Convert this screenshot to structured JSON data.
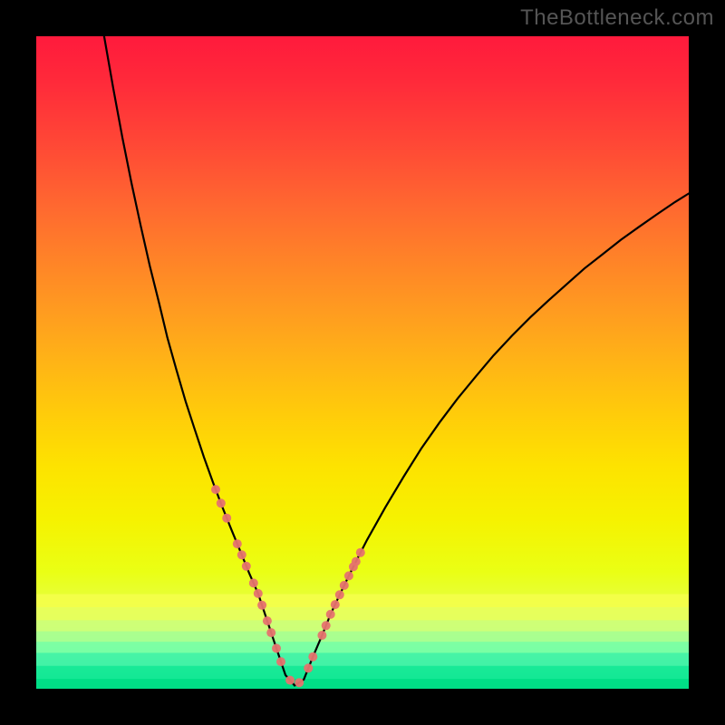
{
  "watermark": "TheBottleneck.com",
  "chart_data": {
    "type": "line",
    "title": "",
    "xlabel": "",
    "ylabel": "",
    "xlim": [
      0,
      100
    ],
    "ylim": [
      0,
      100
    ],
    "grid": false,
    "legend": null,
    "curve": {
      "description": "V-shaped bottleneck curve with minimum near x≈39",
      "min_x": 39,
      "points": [
        {
          "x": 10.4,
          "y": 100.0
        },
        {
          "x": 11.8,
          "y": 92.0
        },
        {
          "x": 13.2,
          "y": 84.5
        },
        {
          "x": 14.6,
          "y": 77.5
        },
        {
          "x": 16.0,
          "y": 71.0
        },
        {
          "x": 17.4,
          "y": 64.8
        },
        {
          "x": 18.8,
          "y": 59.2
        },
        {
          "x": 20.1,
          "y": 53.8
        },
        {
          "x": 21.5,
          "y": 48.8
        },
        {
          "x": 22.9,
          "y": 44.0
        },
        {
          "x": 24.3,
          "y": 39.7
        },
        {
          "x": 25.7,
          "y": 35.5
        },
        {
          "x": 27.1,
          "y": 31.6
        },
        {
          "x": 28.5,
          "y": 27.9
        },
        {
          "x": 29.9,
          "y": 24.4
        },
        {
          "x": 31.3,
          "y": 21.0
        },
        {
          "x": 32.6,
          "y": 17.8
        },
        {
          "x": 34.0,
          "y": 14.6
        },
        {
          "x": 35.4,
          "y": 10.4
        },
        {
          "x": 36.8,
          "y": 6.2
        },
        {
          "x": 38.2,
          "y": 2.1
        },
        {
          "x": 39.6,
          "y": 0.5
        },
        {
          "x": 41.0,
          "y": 1.4
        },
        {
          "x": 42.4,
          "y": 4.9
        },
        {
          "x": 43.8,
          "y": 8.2
        },
        {
          "x": 45.1,
          "y": 11.4
        },
        {
          "x": 46.5,
          "y": 14.4
        },
        {
          "x": 47.9,
          "y": 17.3
        },
        {
          "x": 49.3,
          "y": 20.1
        },
        {
          "x": 50.7,
          "y": 22.8
        },
        {
          "x": 53.5,
          "y": 27.8
        },
        {
          "x": 56.3,
          "y": 32.5
        },
        {
          "x": 59.0,
          "y": 36.8
        },
        {
          "x": 61.8,
          "y": 40.8
        },
        {
          "x": 64.6,
          "y": 44.5
        },
        {
          "x": 67.4,
          "y": 47.9
        },
        {
          "x": 70.1,
          "y": 51.1
        },
        {
          "x": 72.9,
          "y": 54.1
        },
        {
          "x": 75.7,
          "y": 56.9
        },
        {
          "x": 78.5,
          "y": 59.5
        },
        {
          "x": 81.3,
          "y": 62.0
        },
        {
          "x": 84.0,
          "y": 64.4
        },
        {
          "x": 86.8,
          "y": 66.6
        },
        {
          "x": 89.6,
          "y": 68.8
        },
        {
          "x": 92.4,
          "y": 70.8
        },
        {
          "x": 95.1,
          "y": 72.7
        },
        {
          "x": 97.9,
          "y": 74.6
        },
        {
          "x": 100.0,
          "y": 75.9
        }
      ]
    },
    "markers": {
      "color": "#e6736e",
      "size": 10,
      "points_x": [
        27.5,
        28.3,
        29.2,
        30.8,
        31.5,
        32.2,
        33.3,
        34.0,
        34.6,
        35.4,
        36.0,
        36.8,
        37.5,
        38.9,
        40.3,
        41.7,
        42.4,
        43.8,
        44.4,
        45.1,
        45.8,
        46.5,
        47.2,
        47.9,
        48.6,
        49.0,
        49.7
      ]
    },
    "background_gradient": {
      "type": "vertical",
      "stops": [
        {
          "pos": 0.0,
          "color": "#ff1a3c"
        },
        {
          "pos": 0.07,
          "color": "#ff2a3a"
        },
        {
          "pos": 0.16,
          "color": "#ff4636"
        },
        {
          "pos": 0.26,
          "color": "#ff6830"
        },
        {
          "pos": 0.34,
          "color": "#ff8228"
        },
        {
          "pos": 0.42,
          "color": "#ff9b20"
        },
        {
          "pos": 0.5,
          "color": "#ffb416"
        },
        {
          "pos": 0.58,
          "color": "#ffcc0a"
        },
        {
          "pos": 0.66,
          "color": "#fde300"
        },
        {
          "pos": 0.74,
          "color": "#f6f200"
        },
        {
          "pos": 0.82,
          "color": "#eaff14"
        },
        {
          "pos": 0.865,
          "color": "#e6ff3a"
        },
        {
          "pos": 0.895,
          "color": "#d2ff66"
        },
        {
          "pos": 0.915,
          "color": "#b8ff82"
        },
        {
          "pos": 0.935,
          "color": "#8effa0"
        },
        {
          "pos": 0.96,
          "color": "#44f5a8"
        },
        {
          "pos": 0.985,
          "color": "#00e88e"
        },
        {
          "pos": 1.0,
          "color": "#00de84"
        }
      ]
    },
    "overlay_bands": [
      {
        "y_from": 0.855,
        "y_to": 0.875,
        "color": "#f4ff4a",
        "alpha": 0.9
      },
      {
        "y_from": 0.875,
        "y_to": 0.895,
        "color": "#e8ff5c",
        "alpha": 0.9
      },
      {
        "y_from": 0.895,
        "y_to": 0.912,
        "color": "#ceff78",
        "alpha": 0.9
      },
      {
        "y_from": 0.912,
        "y_to": 0.928,
        "color": "#a8ff90",
        "alpha": 0.9
      },
      {
        "y_from": 0.928,
        "y_to": 0.945,
        "color": "#7affa4",
        "alpha": 0.9
      },
      {
        "y_from": 0.945,
        "y_to": 0.965,
        "color": "#44f2a6",
        "alpha": 0.9
      },
      {
        "y_from": 0.965,
        "y_to": 0.985,
        "color": "#16e896",
        "alpha": 0.9
      },
      {
        "y_from": 0.985,
        "y_to": 1.0,
        "color": "#00de86",
        "alpha": 0.9
      }
    ]
  }
}
